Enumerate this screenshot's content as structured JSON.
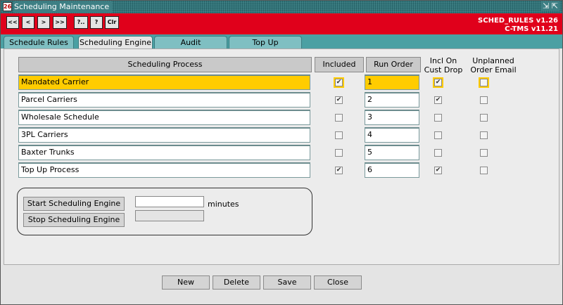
{
  "window": {
    "title": "Scheduling Maintenance",
    "controls": "⇲ ⇱"
  },
  "toolbar": {
    "buttons": [
      "<<",
      "<",
      ">",
      ">>",
      "?..",
      "?",
      "Clr"
    ],
    "version_line1": "SCHED_RULES v1.26",
    "version_line2": "C-TMS v11.21"
  },
  "tabs": [
    "Schedule Rules",
    "Scheduling Engine",
    "Audit",
    "Top Up"
  ],
  "active_tab": "Scheduling Engine",
  "headers": {
    "process": "Scheduling Process",
    "included": "Included",
    "run_order": "Run Order",
    "incl_on_cust_drop": "Incl On Cust Drop",
    "unplanned_order_email": "Unplanned Order Email"
  },
  "rows": [
    {
      "process": "Mandated Carrier",
      "included": true,
      "run_order": "1",
      "incl_on_cust_drop": true,
      "unplanned_email": false,
      "selected": true
    },
    {
      "process": "Parcel Carriers",
      "included": true,
      "run_order": "2",
      "incl_on_cust_drop": true,
      "unplanned_email": false,
      "selected": false
    },
    {
      "process": "Wholesale Schedule",
      "included": false,
      "run_order": "3",
      "incl_on_cust_drop": false,
      "unplanned_email": false,
      "selected": false
    },
    {
      "process": "3PL Carriers",
      "included": false,
      "run_order": "4",
      "incl_on_cust_drop": false,
      "unplanned_email": false,
      "selected": false
    },
    {
      "process": "Baxter Trunks",
      "included": false,
      "run_order": "5",
      "incl_on_cust_drop": false,
      "unplanned_email": false,
      "selected": false
    },
    {
      "process": "Top Up Process",
      "included": true,
      "run_order": "6",
      "incl_on_cust_drop": true,
      "unplanned_email": false,
      "selected": false
    }
  ],
  "engine": {
    "start_label": "Start Scheduling Engine",
    "stop_label": "Stop Scheduling Engine",
    "minutes_value": "",
    "minutes_label": "minutes",
    "status_value": ""
  },
  "actions": [
    "New",
    "Delete",
    "Save",
    "Close"
  ],
  "colors": {
    "accent_red": "#e0001b",
    "highlight": "#ffcc00",
    "tab_teal": "#7fbfc2"
  }
}
